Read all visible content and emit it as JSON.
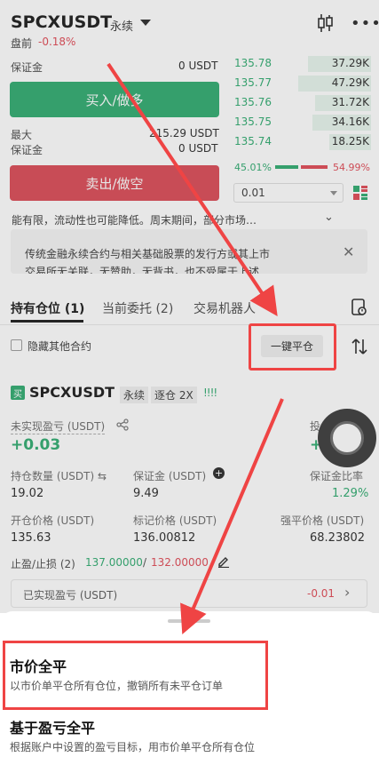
{
  "header": {
    "symbol": "SPCXUSDT",
    "contract_type": "永续",
    "status_label": "盘前",
    "change": "-0.18%",
    "candle_icon": "candlestick-icon",
    "more_icon": "more-dots-icon"
  },
  "trade_panel": {
    "margin_label": "保证金",
    "margin_value": "0 USDT",
    "buy_label": "买入/做多",
    "max_label": "最大",
    "max_value": "215.29 USDT",
    "margin_label2": "保证金",
    "margin_value2": "0 USDT",
    "sell_label": "卖出/做空"
  },
  "order_book": {
    "rows": [
      {
        "price": "135.78",
        "volume": "37.29K",
        "depth": 0.45
      },
      {
        "price": "135.77",
        "volume": "47.29K",
        "depth": 0.52
      },
      {
        "price": "135.76",
        "volume": "31.72K",
        "depth": 0.4
      },
      {
        "price": "135.75",
        "volume": "34.16K",
        "depth": 0.42
      },
      {
        "price": "135.74",
        "volume": "18.25K",
        "depth": 0.3
      }
    ],
    "buy_ratio": "45.01%",
    "sell_ratio": "54.99%",
    "precision": "0.01"
  },
  "notice": {
    "line1": "能有限，流动性也可能降低。周末期间，部分市场…",
    "line2": "传统金融永续合约与相关基础股票的发行方或其上市",
    "line3": "交易所无关联，无赞助，无背书，也不受属于上述…"
  },
  "tabs": {
    "positions": "持有仓位 (1)",
    "orders": "当前委托 (2)",
    "bots": "交易机器人"
  },
  "filter": {
    "hide_label": "隐藏其他合约",
    "close_all_label": "一键平仓"
  },
  "position": {
    "badge": "买",
    "symbol": "SPCXUSDT",
    "type": "永续",
    "margin_mode": "逐仓 2X",
    "bars": "!!!!",
    "pnl_label": "未实现盈亏 (USDT)",
    "pnl_value": "+0.03",
    "pnl_right_label": "投",
    "pnl_right_value": "+",
    "qty_label": "持仓数量 (USDT) ⇆",
    "qty_value": "19.02",
    "margin_label": "保证金 (USDT)",
    "margin_value": "9.49",
    "ratio_label": "保证金比率",
    "ratio_value": "1.29%",
    "open_label": "开仓价格 (USDT)",
    "open_value": "135.63",
    "mark_label": "标记价格 (USDT)",
    "mark_value": "136.00812",
    "liq_label": "强平价格 (USDT)",
    "liq_value": "68.23802",
    "sltp_label": "止盈/止损 (2)",
    "tp_value": "137.00000",
    "sl_value": "132.00000",
    "realized_label": "已实现盈亏 (USDT)",
    "realized_value": "-0.01"
  },
  "sheet": {
    "option1_title": "市价全平",
    "option1_desc": "以市价单平仓所有仓位，撤销所有未平仓订单",
    "option2_title": "基于盈亏全平",
    "option2_desc": "根据账户中设置的盈亏目标，用市价单平仓所有仓位"
  },
  "colors": {
    "green": "#26a86a",
    "red": "#e0434f",
    "annotation": "#ef4444"
  }
}
